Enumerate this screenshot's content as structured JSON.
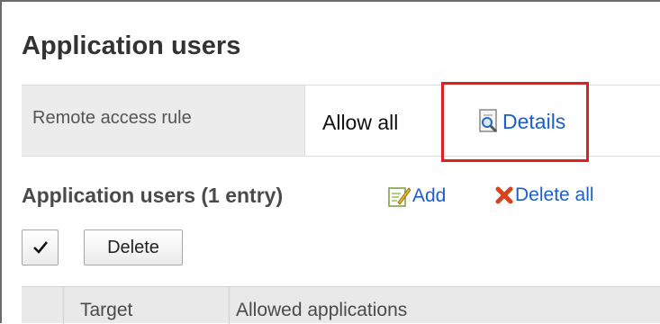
{
  "page": {
    "title": "Application users"
  },
  "remote_access": {
    "label": "Remote access rule",
    "value": "Allow all",
    "details_link": "Details"
  },
  "users_section": {
    "title": "Application users (1 entry)",
    "add_label": "Add",
    "delete_all_label": "Delete all"
  },
  "toolbar": {
    "delete_label": "Delete"
  },
  "table": {
    "columns": [
      "",
      "Target",
      "Allowed applications"
    ]
  },
  "colors": {
    "link": "#1a5fcc",
    "highlight": "#e02020",
    "label_bg": "#ececec"
  },
  "icons": {
    "details": "magnifier-document-icon",
    "add": "pencil-note-icon",
    "delete_all": "red-x-icon",
    "select_all": "checkmark-icon"
  }
}
